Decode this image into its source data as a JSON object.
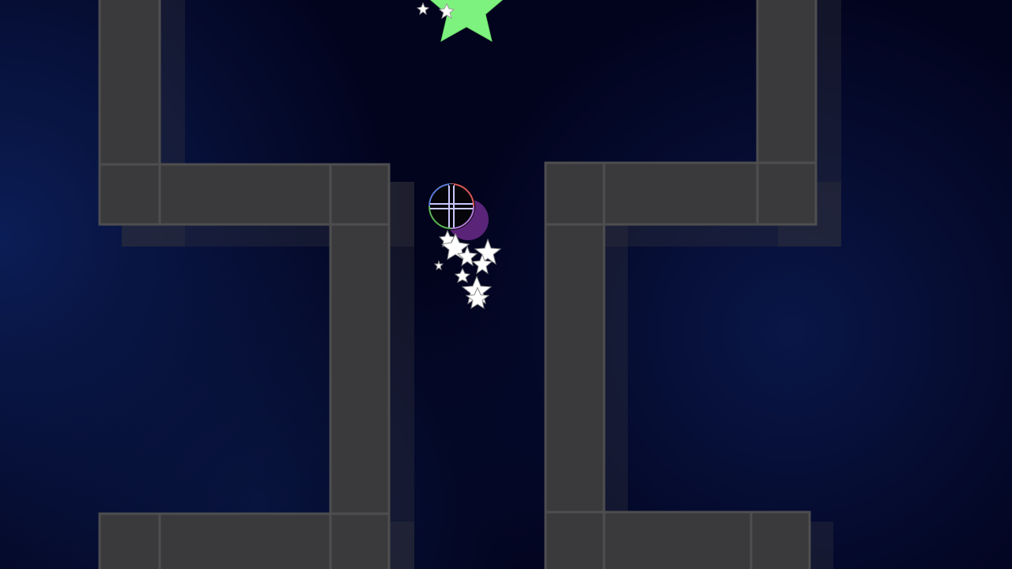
{
  "game": {
    "background_colors": [
      "#0a1a4a",
      "#030626",
      "#01010e"
    ],
    "wall_color": "#3a3a3a",
    "wall_border_color": "#4d4d4d",
    "wall_shadow_color": "#2c2c34",
    "goal_star_color": "#7ff07f",
    "trail_star_color": "#ffffff",
    "player_ball": {
      "quadrant_outline_colors": [
        "#b07ad8",
        "#d8585c",
        "#5ab45a",
        "#5a7ad8"
      ],
      "cross_color": "#d0d0ff",
      "shadow_color": "#6a2a8a"
    },
    "icons": [
      "goal-star-icon",
      "player-ball-icon",
      "trail-star-icon",
      "wall-block"
    ]
  }
}
